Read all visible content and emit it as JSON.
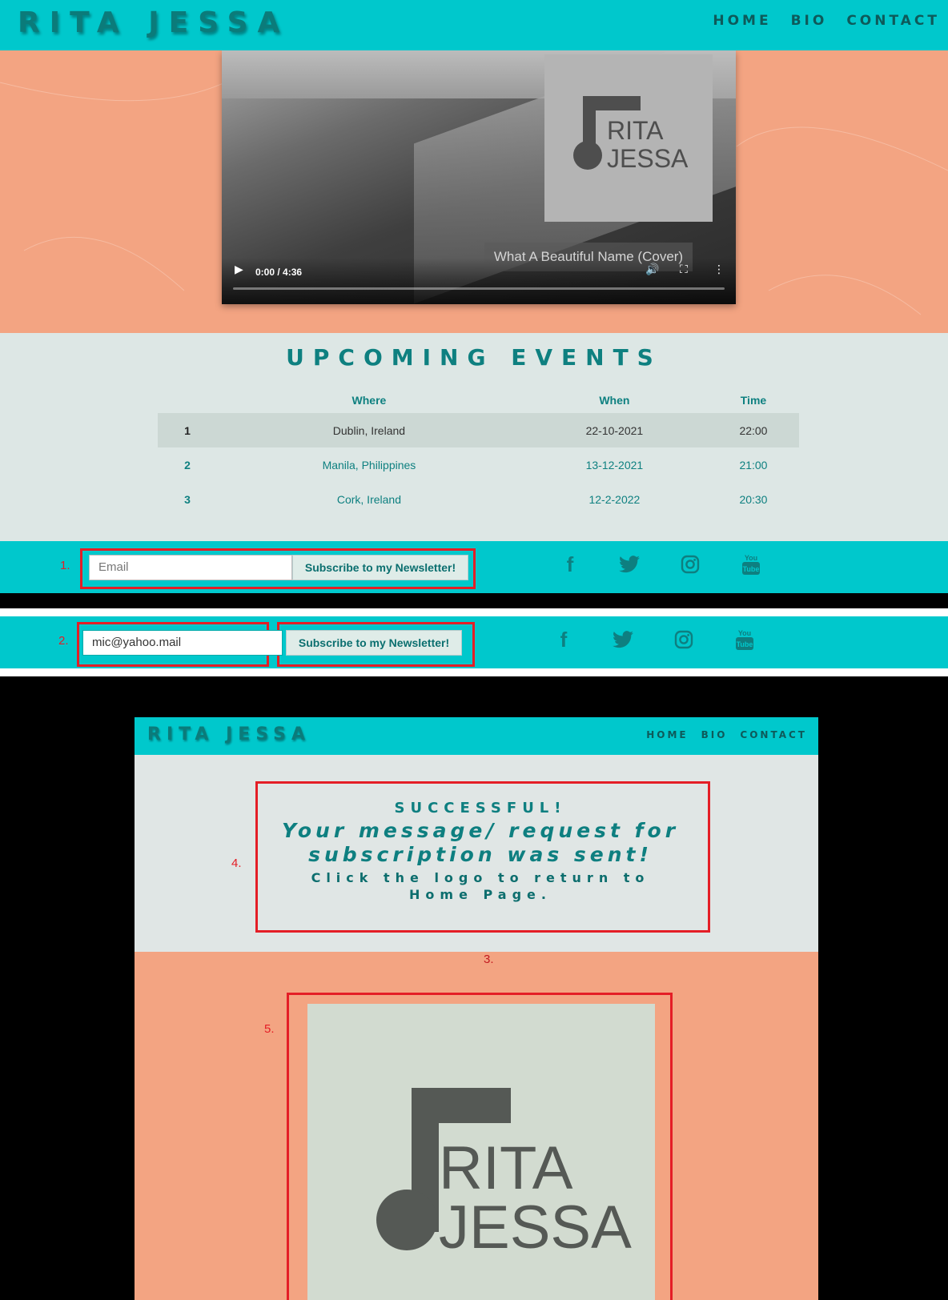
{
  "header": {
    "brand": "RITA JESSA",
    "nav": [
      "HOME",
      "BIO",
      "CONTACT"
    ]
  },
  "video": {
    "title": "What A Beautiful Name (Cover)",
    "time": "0:00 / 4:36",
    "logo_line1": "RITA",
    "logo_line2": "JESSA",
    "progress": 0
  },
  "events": {
    "title": "UPCOMING EVENTS",
    "columns": [
      "",
      "Where",
      "When",
      "Time"
    ],
    "rows": [
      {
        "num": "1",
        "where": "Dublin, Ireland",
        "when": "22-10-2021",
        "time": "22:00"
      },
      {
        "num": "2",
        "where": "Manila, Philippines",
        "when": "13-12-2021",
        "time": "21:00"
      },
      {
        "num": "3",
        "where": "Cork, Ireland",
        "when": "12-2-2022",
        "time": "20:30"
      }
    ]
  },
  "newsletter1": {
    "step": "1.",
    "email_placeholder": "Email",
    "button": "Subscribe to my Newsletter!"
  },
  "newsletter2": {
    "step": "2.",
    "email_value": "mic@yahoo.mail",
    "button": "Subscribe to my Newsletter!"
  },
  "social": [
    "facebook-icon",
    "twitter-icon",
    "instagram-icon",
    "youtube-icon"
  ],
  "success_page": {
    "brand": "RITA JESSA",
    "nav": [
      "HOME",
      "BIO",
      "CONTACT"
    ],
    "line1": "SUCCESSFUL!",
    "line2": "Your message/ request for subscription was sent!",
    "line3": "Click the logo to return to Home Page.",
    "step_message": "4.",
    "step_section": "3.",
    "step_logo": "5.",
    "logo_line1": "RITA",
    "logo_line2": "JESSA"
  },
  "colors": {
    "teal_bar": "#00c8cc",
    "teal_text": "#0e8080",
    "peach": "#f3a482",
    "annotation_red": "#e41e26"
  }
}
